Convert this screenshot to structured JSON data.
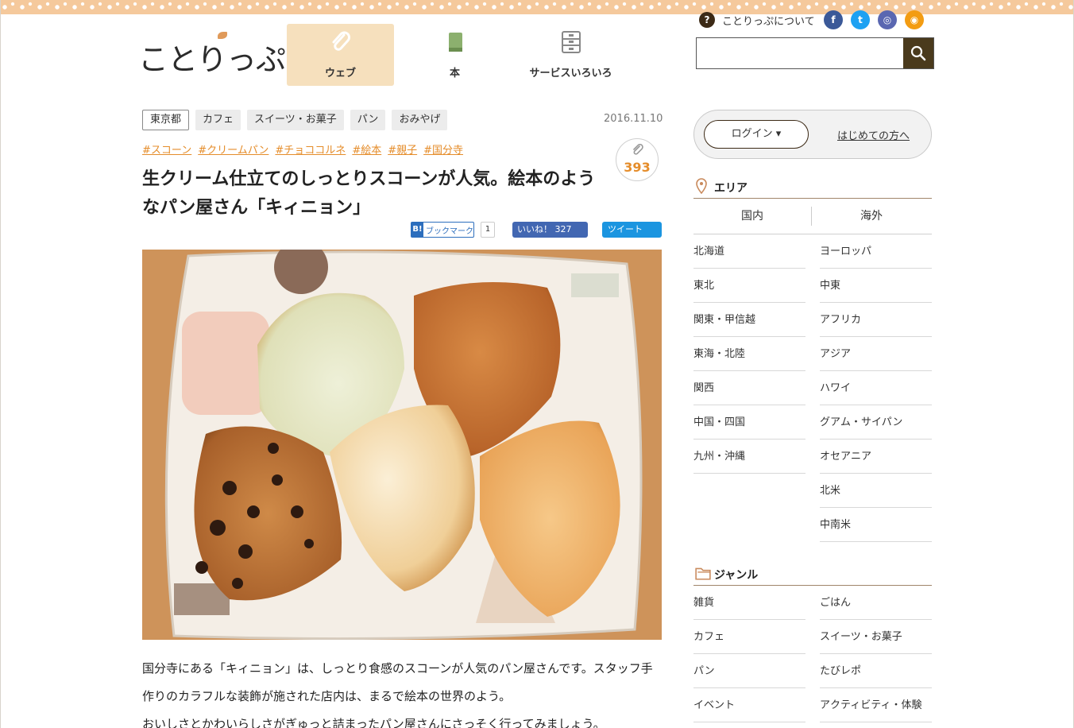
{
  "site": {
    "logo_text": "ことりっぷ"
  },
  "nav": [
    {
      "label": "ウェブ",
      "icon": "paperclip-icon",
      "active": true
    },
    {
      "label": "本",
      "icon": "book-icon",
      "active": false
    },
    {
      "label": "サービスいろいろ",
      "icon": "drawer-icon",
      "active": false
    }
  ],
  "header": {
    "about_icon": "?",
    "about_label": "ことりっぷについて",
    "social": [
      {
        "name": "facebook",
        "glyph": "f"
      },
      {
        "name": "twitter",
        "glyph": "t"
      },
      {
        "name": "instagram",
        "glyph": "◎"
      },
      {
        "name": "rss",
        "glyph": "◉"
      }
    ],
    "search": {
      "value": "",
      "placeholder": ""
    }
  },
  "article": {
    "tags": [
      "東京都",
      "カフェ",
      "スイーツ・お菓子",
      "パン",
      "おみやげ"
    ],
    "date": "2016.11.10",
    "hashtags": [
      "#スコーン",
      "#クリームパン",
      "#チョココルネ",
      "#絵本",
      "#親子",
      "#国分寺"
    ],
    "clip_count": "393",
    "title": "生クリーム仕立てのしっとりスコーンが人気。絵本のようなパン屋さん「キィニョン」",
    "share": {
      "hatena_icon": "B!",
      "hatena_label": "ブックマーク",
      "hatena_count": "1",
      "fb_label": "いいね！ 327",
      "tw_label": "ツイート"
    },
    "body": [
      "国分寺にある「キィニョン」は、しっとり食感のスコーンが人気のパン屋さんです。スタッフ手作りのカラフルな装飾が施された店内は、まるで絵本の世界のよう。",
      "おいしさとかわいらしさがぎゅっと詰まったパン屋さんにさっそく行ってみましょう。"
    ]
  },
  "sidebar": {
    "login_label": "ログイン ▾",
    "first_time_label": "はじめての方へ",
    "area": {
      "title": "エリア",
      "tabs": [
        "国内",
        "海外"
      ],
      "domestic": [
        "北海道",
        "東北",
        "関東・甲信越",
        "東海・北陸",
        "関西",
        "中国・四国",
        "九州・沖縄"
      ],
      "overseas": [
        "ヨーロッパ",
        "中東",
        "アフリカ",
        "アジア",
        "ハワイ",
        "グアム・サイパン",
        "オセアニア",
        "北米",
        "中南米"
      ]
    },
    "genre": {
      "title": "ジャンル",
      "left": [
        "雑貨",
        "カフェ",
        "パン",
        "イベント"
      ],
      "right": [
        "ごはん",
        "スイーツ・お菓子",
        "たびレポ",
        "アクティビティ・体験"
      ]
    }
  },
  "colors": {
    "accent": "#e58d2b",
    "brown": "#4a3a1c",
    "nav_active": "#f6e0bd"
  }
}
